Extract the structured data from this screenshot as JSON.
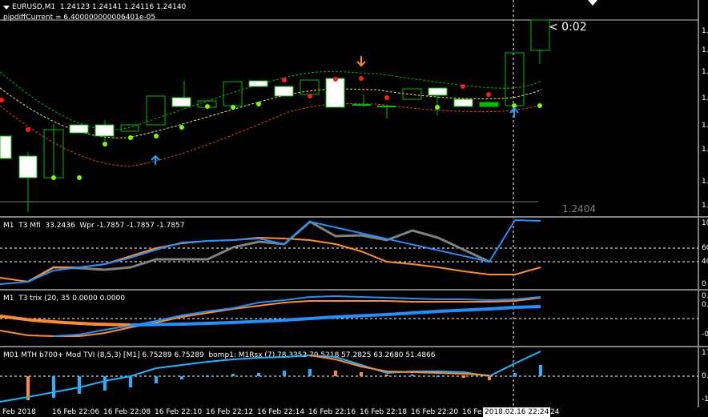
{
  "main": {
    "title": "EURUSD,M1  1.24123 1.24141 1.24116 1.24140",
    "subtitle": "pipdiffCurrent = 6.400000000006401e-05",
    "countdown": "< 0:02",
    "last_price_label": "1.2404",
    "price_axis_labels": [
      "1.",
      "1.",
      "1.",
      "1.",
      "1.",
      "1.",
      "1.",
      "1."
    ]
  },
  "sub1": {
    "title": "M1  T3 Mfi  33.2436  Wpr -1.7857 -1.7857 -1.7857",
    "axis_labels": [
      "10",
      "60",
      "40",
      "0"
    ]
  },
  "sub2": {
    "title": "M1  T3 trix (20, 35 0.0000 0.0000",
    "axis_labels": [
      "0.",
      "0.",
      "-0"
    ]
  },
  "sub3": {
    "title": "M01 MTH b700+ Mod TVI (8,5,3) [M1] 6.75289 6.75289  bomp1: M1Rsx (7) 78.3352 70.5218 57.2825 63.2680 51.4866",
    "axis_labels": [
      "17",
      "0.",
      "-1"
    ]
  },
  "time_axis": {
    "labels": [
      "Feb 2018",
      "16 Feb 22:06",
      "16 Feb 22:08",
      "16 Feb 22:10",
      "16 Feb 22:12",
      "16 Feb 22:14",
      "16 Feb 22:16",
      "16 Feb 22:18",
      "16 Feb 22:20",
      "16 Fe"
    ],
    "cursor_label": "2018.02.16 22:24",
    "trailing_label": ":24"
  },
  "colors": {
    "background": "#000000",
    "bull_candle": "#ffffff",
    "candle_outline": "#00c000",
    "upper_band": "#00b400",
    "mid_band": "#e6e650",
    "lower_band": "#e0402a",
    "dot_green": "#7cfc00",
    "dot_red": "#ff1e1e",
    "arrow_up": "#1ea0ff",
    "arrow_down": "#ff8c1e",
    "mfi_gray": "#808080",
    "mfi_blue": "#1e90ff",
    "mfi_orange": "#ff8c28",
    "tvi_cyan": "#1eb4ff",
    "tvi_orange": "#ff8c28"
  }
}
